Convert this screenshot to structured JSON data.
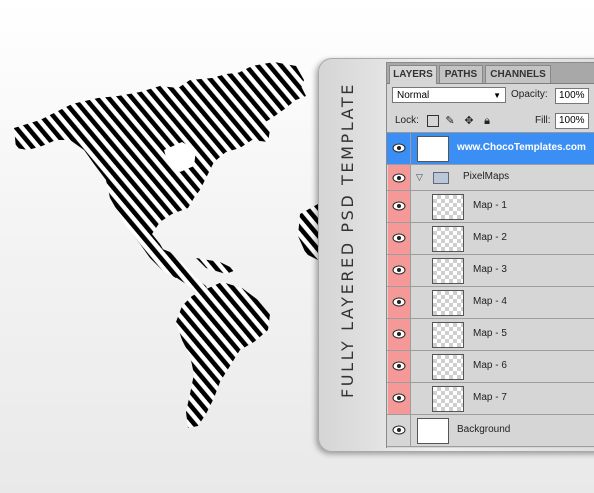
{
  "vertical_title": "FULLY LAYERED PSD TEMPLATE",
  "tabs": [
    {
      "label": "LAYERS",
      "active": true
    },
    {
      "label": "PATHS",
      "active": false
    },
    {
      "label": "CHANNELS",
      "active": false
    }
  ],
  "blend_mode": "Normal",
  "opacity": {
    "label": "Opacity:",
    "value": "100%"
  },
  "lock": {
    "label": "Lock:",
    "icons": [
      "transparency-lock-icon",
      "brush-lock-icon",
      "move-lock-icon",
      "padlock-icon"
    ]
  },
  "fill": {
    "label": "Fill:",
    "value": "100%"
  },
  "layers": {
    "top": {
      "name": "www.ChocoTemplates.com"
    },
    "group": {
      "name": "PixelMaps"
    },
    "maps": [
      {
        "name": "Map - 1"
      },
      {
        "name": "Map - 2"
      },
      {
        "name": "Map - 3"
      },
      {
        "name": "Map - 4"
      },
      {
        "name": "Map - 5"
      },
      {
        "name": "Map - 6"
      },
      {
        "name": "Map - 7"
      }
    ],
    "background": {
      "name": "Background"
    }
  },
  "colors": {
    "selection": "#3b8ff4",
    "eye_highlight": "#f59898",
    "map_stripes": "#000000"
  }
}
